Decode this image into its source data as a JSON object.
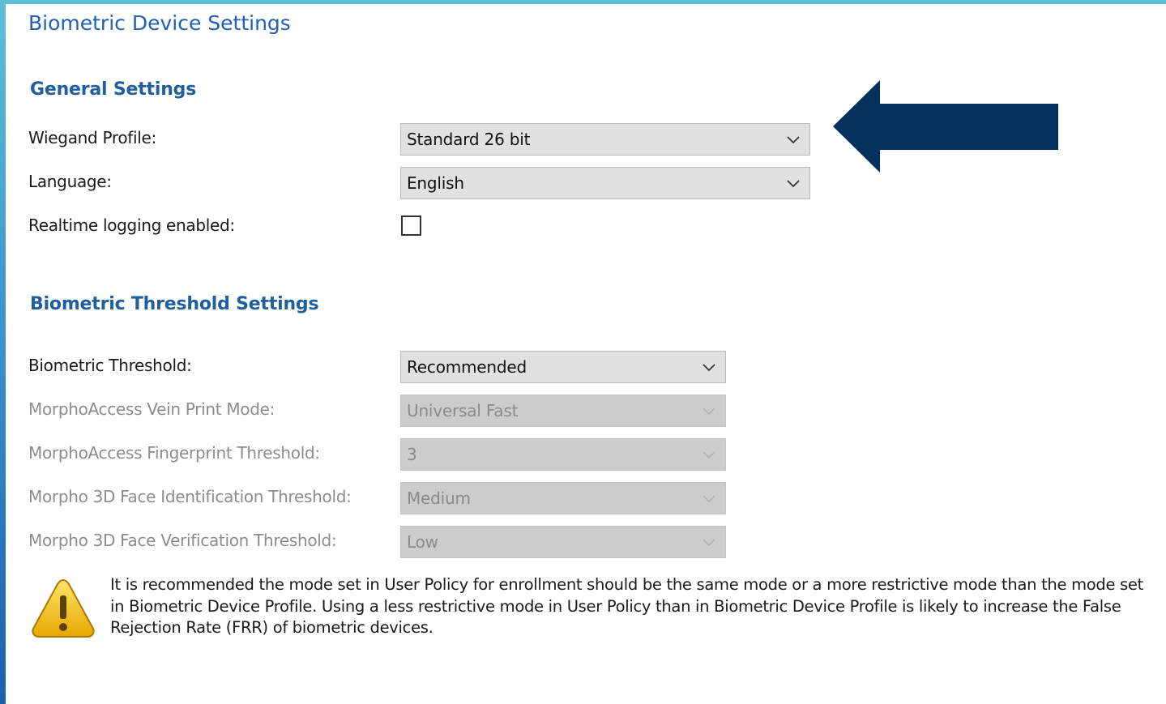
{
  "window": {
    "title": "Biometric Device Settings"
  },
  "general": {
    "title": "General Settings",
    "wiegand_label": "Wiegand Profile:",
    "wiegand_value": "Standard 26 bit",
    "language_label": "Language:",
    "language_value": "English",
    "realtime_label": "Realtime logging enabled:",
    "realtime_checked": false
  },
  "threshold": {
    "title": "Biometric Threshold Settings",
    "biometric_label": "Biometric Threshold:",
    "biometric_value": "Recommended",
    "vein_label": "MorphoAccess Vein Print Mode:",
    "vein_value": "Universal Fast",
    "fingerprint_label": "MorphoAccess Fingerprint Threshold:",
    "fingerprint_value": "3",
    "face_id_label": "Morpho 3D Face Identification Threshold:",
    "face_id_value": "Medium",
    "face_verify_label": "Morpho 3D Face Verification Threshold:",
    "face_verify_value": "Low"
  },
  "warning": {
    "icon": "warning-icon",
    "text": "It is recommended the mode set in User Policy for enrollment should be the same mode or a more restrictive mode than the mode set in Biometric Device Profile.  Using a less restrictive mode in User Policy than in Biometric Device Profile is likely to increase the False Rejection Rate (FRR) of biometric devices."
  },
  "annotation": {
    "icon": "left-arrow-icon",
    "color": "#05305e"
  },
  "colors": {
    "accent": "#1f5f9e",
    "frame": "#5cc0dc",
    "warning": "#f2c200"
  }
}
